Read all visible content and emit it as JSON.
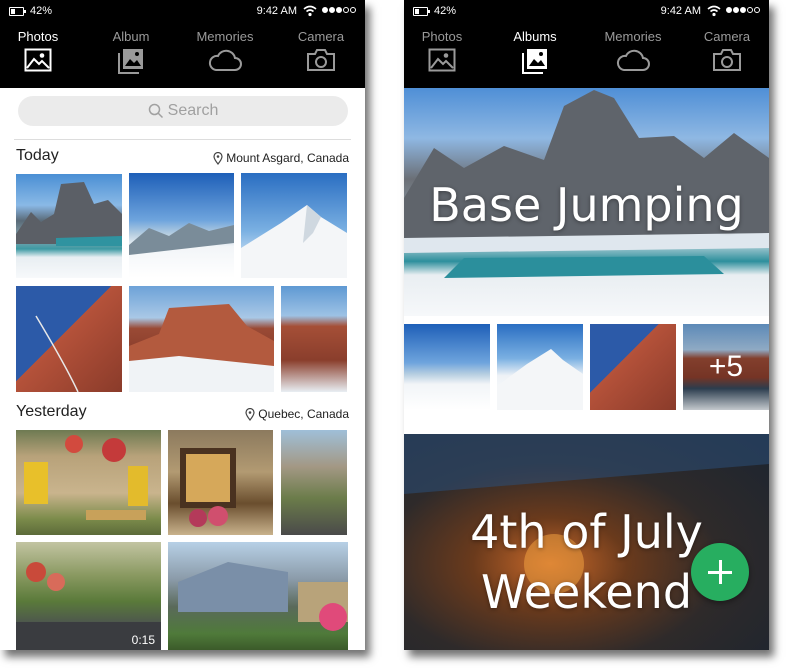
{
  "status_bar": {
    "battery_percent": "42%",
    "time": "9:42 AM",
    "signal_bars": 3
  },
  "tabs": [
    {
      "label": "Photos",
      "icon": "photos-icon"
    },
    {
      "label": "Album",
      "icon": "album-icon"
    },
    {
      "label": "Memories",
      "icon": "cloud-icon"
    },
    {
      "label": "Camera",
      "icon": "camera-icon"
    }
  ],
  "tabs_right": [
    {
      "label": "Photos",
      "icon": "photos-icon"
    },
    {
      "label": "Albums",
      "icon": "album-icon"
    },
    {
      "label": "Memories",
      "icon": "cloud-icon"
    },
    {
      "label": "Camera",
      "icon": "camera-icon"
    }
  ],
  "photos_view": {
    "active_tab": "Photos",
    "search": {
      "placeholder": "Search"
    },
    "sections": [
      {
        "title": "Today",
        "location": "Mount Asgard, Canada",
        "photo_count": 6
      },
      {
        "title": "Yesterday",
        "location": "Quebec, Canada",
        "photo_count": 5,
        "video_duration": "0:15"
      }
    ]
  },
  "albums_view": {
    "active_tab": "Albums",
    "albums": [
      {
        "title": "Base Jumping",
        "more_count": "+5"
      },
      {
        "title_line1": "4th of July",
        "title_line2": "Weekend"
      }
    ],
    "fab_icon": "plus-icon"
  },
  "colors": {
    "header_bg": "#000000",
    "active_tab": "#ffffff",
    "inactive_tab": "#9a9a9a",
    "fab": "#27ae60"
  }
}
